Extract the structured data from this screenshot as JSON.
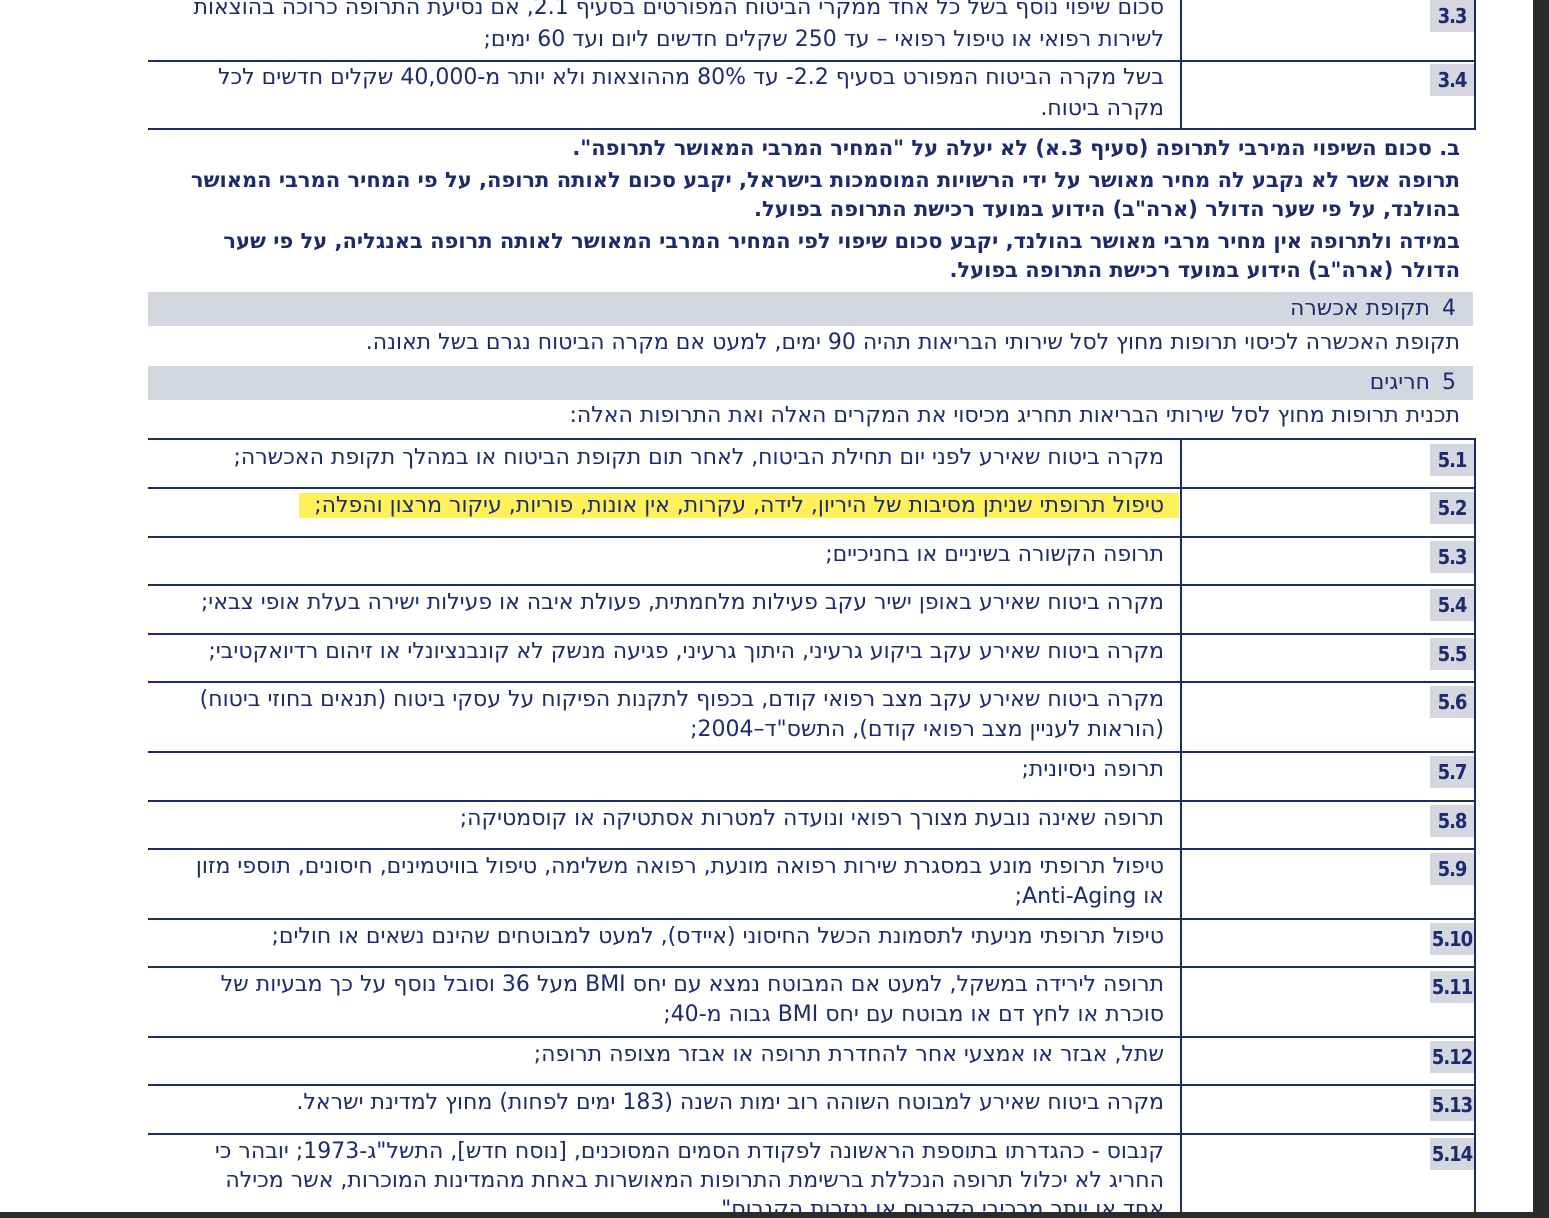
{
  "section3": {
    "row_3_3": {
      "number": "3.3",
      "line1": "סכום שיפוי נוסף בשל כל אחד ממקרי הביטוח המפורטים בסעיף 2.1, אם נסיעת התרופה כרוכה בהוצאות",
      "line2": "לשירות רפואי או טיפול רפואי – עד 250 שקלים חדשים ליום ועד 60 ימים;"
    },
    "row_3_4": {
      "number": "3.4",
      "line1": "בשל מקרה הביטוח המפורט בסעיף 2.2- עד 80% מההוצאות ולא יותר מ-40,000 שקלים חדשים לכל",
      "line2": "מקרה ביטוח."
    },
    "clause_b": {
      "line1": "ב. סכום השיפוי המירבי לתרופה (סעיף 3.א) לא יעלה על \"המחיר המרבי המאושר לתרופה\".",
      "line2": "תרופה אשר לא נקבע לה מחיר מאושר על ידי הרשויות המוסמכות בישראל, יקבע סכום לאותה תרופה, על פי המחיר המרבי המאושר",
      "line3": "בהולנד, על פי שער הדולר (ארה\"ב) הידוע במועד רכישת התרופה בפועל.",
      "line4": "במידה ולתרופה אין מחיר מרבי מאושר בהולנד, יקבע סכום שיפוי לפי המחיר המרבי המאושר לאותה תרופה באנגליה, על פי שער",
      "line5": "הדולר (ארה\"ב) הידוע במועד רכישת התרופה בפועל."
    }
  },
  "section4": {
    "number": "4",
    "title": "תקופת אכשרה",
    "text": "תקופת האכשרה לכיסוי תרופות מחוץ לסל שירותי הבריאות תהיה 90 ימים, למעט אם מקרה הביטוח נגרם בשל תאונה."
  },
  "section5": {
    "number": "5",
    "title": "חריגים",
    "intro": "תכנית תרופות מחוץ לסל שירותי הבריאות תחריג מכיסוי את המקרים האלה ואת התרופות האלה:",
    "rows": [
      {
        "number": "5.1",
        "lines": [
          "מקרה ביטוח שאירע לפני יום תחילת הביטוח, לאחר תום תקופת הביטוח או במהלך תקופת האכשרה;"
        ]
      },
      {
        "number": "5.2",
        "highlighted": true,
        "lines": [
          "טיפול תרופתי שניתן מסיבות של היריון, לידה, עקרות, אין אונות, פוריות, עיקור מרצון והפלה;"
        ]
      },
      {
        "number": "5.3",
        "lines": [
          "תרופה הקשורה בשיניים או בחניכיים;"
        ]
      },
      {
        "number": "5.4",
        "lines": [
          "מקרה ביטוח שאירע באופן ישיר עקב פעילות מלחמתית, פעולת איבה או פעילות ישירה בעלת אופי צבאי;"
        ]
      },
      {
        "number": "5.5",
        "lines": [
          "מקרה ביטוח שאירע עקב ביקוע גרעיני, היתוך גרעיני, פגיעה מנשק לא קונבנציונלי או זיהום רדיואקטיבי;"
        ]
      },
      {
        "number": "5.6",
        "lines": [
          "מקרה ביטוח שאירע עקב מצב רפואי קודם, בכפוף לתקנות הפיקוח על עסקי ביטוח (תנאים בחוזי ביטוח)",
          "(הוראות לעניין מצב רפואי קודם), התשס\"ד–2004;"
        ]
      },
      {
        "number": "5.7",
        "lines": [
          "תרופה ניסיונית;"
        ]
      },
      {
        "number": "5.8",
        "lines": [
          "תרופה שאינה נובעת מצורך רפואי ונועדה למטרות אסתטיקה או קוסמטיקה;"
        ]
      },
      {
        "number": "5.9",
        "lines": [
          "טיפול תרופתי מונע במסגרת שירות רפואה מונעת, רפואה משלימה, טיפול בוויטמינים, חיסונים, תוספי מזון",
          "או Anti-Aging;"
        ]
      },
      {
        "number": "5.10",
        "lines": [
          "טיפול תרופתי מניעתי לתסמונת הכשל החיסוני (איידס), למעט למבוטחים שהינם נשאים או חולים;"
        ]
      },
      {
        "number": "5.11",
        "lines": [
          "תרופה לירידה במשקל, למעט אם המבוטח נמצא עם יחס BMI מעל 36 וסובל נוסף על כך מבעיות של",
          "סוכרת או לחץ דם או מבוטח עם יחס BMI גבוה מ-40;"
        ]
      },
      {
        "number": "5.12",
        "lines": [
          "שתל, אבזר או אמצעי אחר להחדרת תרופה או אבזר מצופה תרופה;"
        ]
      },
      {
        "number": "5.13",
        "lines": [
          "מקרה ביטוח שאירע למבוטח השוהה רוב ימות השנה (183 ימים לפחות) מחוץ למדינת ישראל."
        ]
      },
      {
        "number": "5.14",
        "lines": [
          "קנבוס - כהגדרתו בתוספת הראשונה לפקודת הסמים המסוכנים, [נוסח חדש], התשל\"ג-1973; יובהר כי",
          "החריג לא יכלול תרופה הנכללת ברשימת התרופות המאושרות באחת מהמדינות המוכרות, אשר מכילה",
          "אחד או יותר מרכיבי הקנבוס או נגזרות הקנבוס\""
        ]
      }
    ]
  },
  "colors": {
    "text": "#1d2a6b",
    "number_badge": "#d4d7df",
    "section_band": "#d4d7df",
    "highlight": "#fff15a",
    "frame": "#2b2b2b"
  }
}
